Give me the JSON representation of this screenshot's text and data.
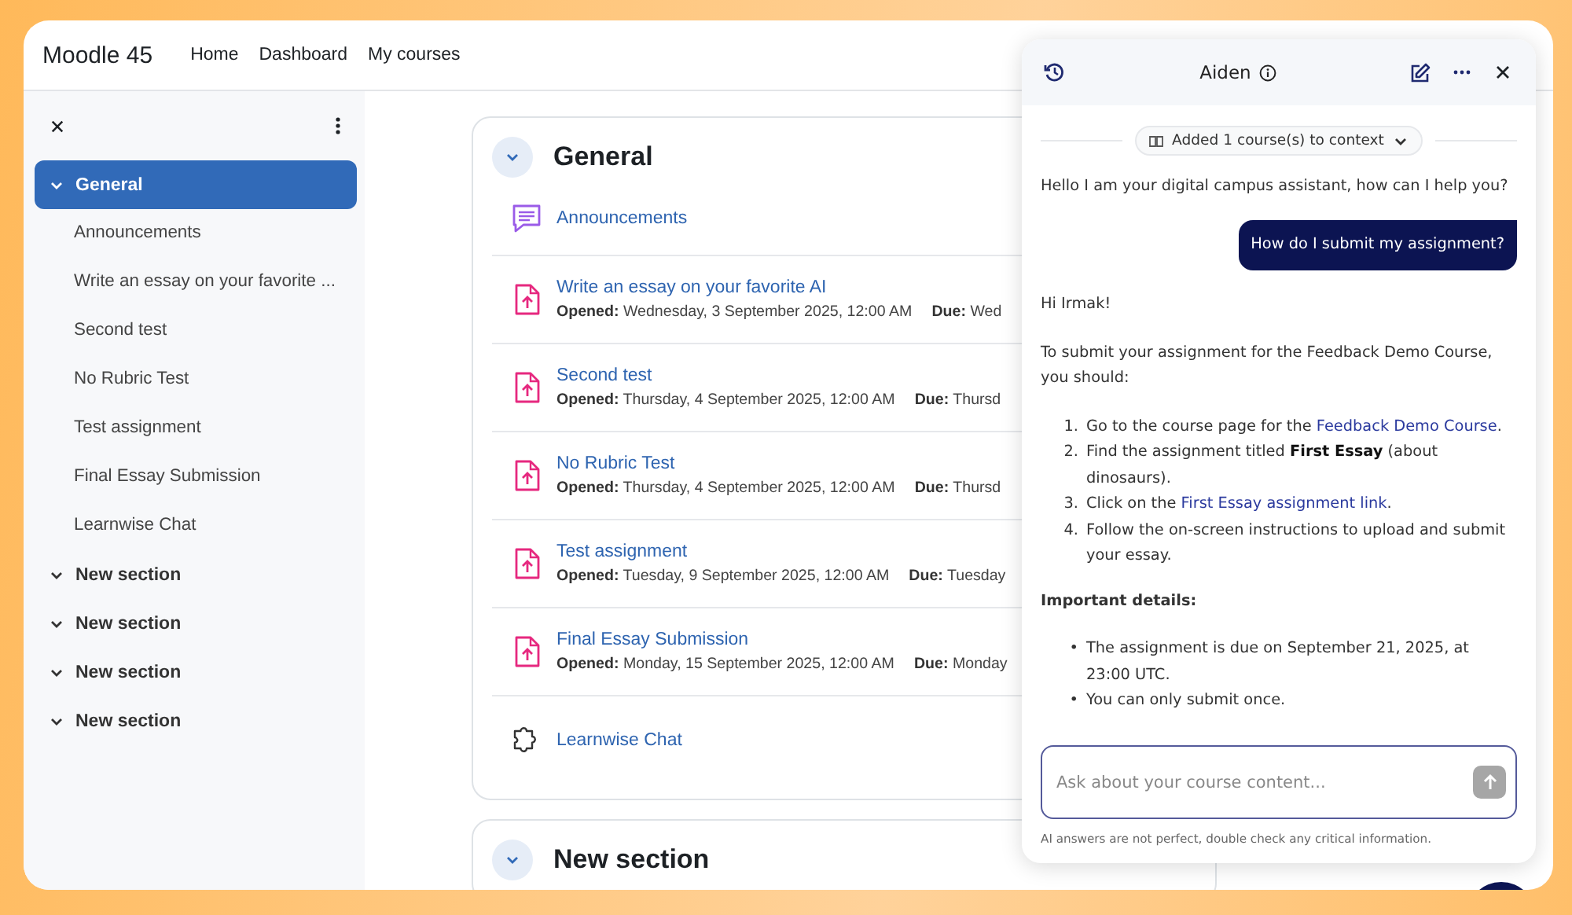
{
  "app": {
    "title": "Moodle 45"
  },
  "nav": [
    {
      "label": "Home"
    },
    {
      "label": "Dashboard"
    },
    {
      "label": "My courses"
    }
  ],
  "sidebar": {
    "items": [
      {
        "label": "General",
        "expanded": true,
        "selected": true,
        "children": [
          {
            "label": "Announcements"
          },
          {
            "label": "Write an essay on your favorite ..."
          },
          {
            "label": "Second test"
          },
          {
            "label": "No Rubric Test"
          },
          {
            "label": "Test assignment"
          },
          {
            "label": "Final Essay Submission"
          },
          {
            "label": "Learnwise Chat"
          }
        ]
      },
      {
        "label": "New section",
        "expanded": true,
        "selected": false
      },
      {
        "label": "New section",
        "expanded": true,
        "selected": false
      },
      {
        "label": "New section",
        "expanded": true,
        "selected": false
      },
      {
        "label": "New section",
        "expanded": true,
        "selected": false
      }
    ]
  },
  "course": {
    "sections": [
      {
        "title": "General",
        "expanded": true,
        "activities": [
          {
            "kind": "forum",
            "name": "Announcements"
          },
          {
            "kind": "assignment",
            "name": "Write an essay on your favorite AI",
            "opened_label": "Opened:",
            "opened": "Wednesday, 3 September 2025, 12:00 AM",
            "due_label": "Due:",
            "due": "Wed"
          },
          {
            "kind": "assignment",
            "name": "Second test",
            "opened_label": "Opened:",
            "opened": "Thursday, 4 September 2025, 12:00 AM",
            "due_label": "Due:",
            "due": "Thursd"
          },
          {
            "kind": "assignment",
            "name": "No Rubric Test",
            "opened_label": "Opened:",
            "opened": "Thursday, 4 September 2025, 12:00 AM",
            "due_label": "Due:",
            "due": "Thursd"
          },
          {
            "kind": "assignment",
            "name": "Test assignment",
            "opened_label": "Opened:",
            "opened": "Tuesday, 9 September 2025, 12:00 AM",
            "due_label": "Due:",
            "due": "Tuesday"
          },
          {
            "kind": "assignment",
            "name": "Final Essay Submission",
            "opened_label": "Opened:",
            "opened": "Monday, 15 September 2025, 12:00 AM",
            "due_label": "Due:",
            "due": "Monday"
          },
          {
            "kind": "chat",
            "name": "Learnwise Chat"
          }
        ]
      },
      {
        "title": "New section",
        "expanded": true
      }
    ]
  },
  "chat": {
    "title": "Aiden",
    "context": "Added 1 course(s) to context",
    "messages": [
      {
        "kind": "assistant",
        "blocks": [
          {
            "kind": "paragraph",
            "segments": [
              {
                "kind": "text",
                "text": "Hello I am your digital campus assistant, how can I help you?"
              }
            ]
          }
        ]
      },
      {
        "kind": "user",
        "text": "How do I submit my assignment?"
      },
      {
        "kind": "assistant",
        "blocks": [
          {
            "kind": "paragraph",
            "segments": [
              {
                "kind": "text",
                "text": "Hi Irmak!"
              }
            ]
          },
          {
            "kind": "paragraph",
            "segments": [
              {
                "kind": "text",
                "text": "To submit your assignment for the Feedback Demo Course, you should:"
              }
            ]
          },
          {
            "kind": "list",
            "items": [
              {
                "marker": "1.",
                "segments": [
                  {
                    "kind": "text",
                    "text": "Go to the course page for the "
                  },
                  {
                    "kind": "link",
                    "text": "Feedback Demo Course"
                  },
                  {
                    "kind": "text",
                    "text": "."
                  }
                ]
              },
              {
                "marker": "2.",
                "segments": [
                  {
                    "kind": "text",
                    "text": "Find the assignment titled "
                  },
                  {
                    "kind": "bold",
                    "text": "First Essay"
                  },
                  {
                    "kind": "text",
                    "text": " (about dinosaurs)."
                  }
                ]
              },
              {
                "marker": "3.",
                "segments": [
                  {
                    "kind": "text",
                    "text": "Click on the "
                  },
                  {
                    "kind": "link",
                    "text": "First Essay assignment link"
                  },
                  {
                    "kind": "text",
                    "text": "."
                  }
                ]
              },
              {
                "marker": "4.",
                "segments": [
                  {
                    "kind": "text",
                    "text": "Follow the on-screen instructions to upload and submit your essay."
                  }
                ]
              }
            ]
          },
          {
            "kind": "heading",
            "segments": [
              {
                "kind": "text",
                "text": "Important details:"
              }
            ]
          },
          {
            "kind": "list",
            "items": [
              {
                "marker": "•",
                "segments": [
                  {
                    "kind": "text",
                    "text": "The assignment is due on September 21, 2025, at 23:00 UTC."
                  }
                ]
              },
              {
                "marker": "•",
                "segments": [
                  {
                    "kind": "text",
                    "text": "You can only submit once."
                  }
                ]
              }
            ]
          }
        ]
      }
    ],
    "input": {
      "placeholder": "Ask about your course content...",
      "send_disabled": true
    },
    "disclaimer": "AI answers are not perfect, double check any critical information."
  }
}
